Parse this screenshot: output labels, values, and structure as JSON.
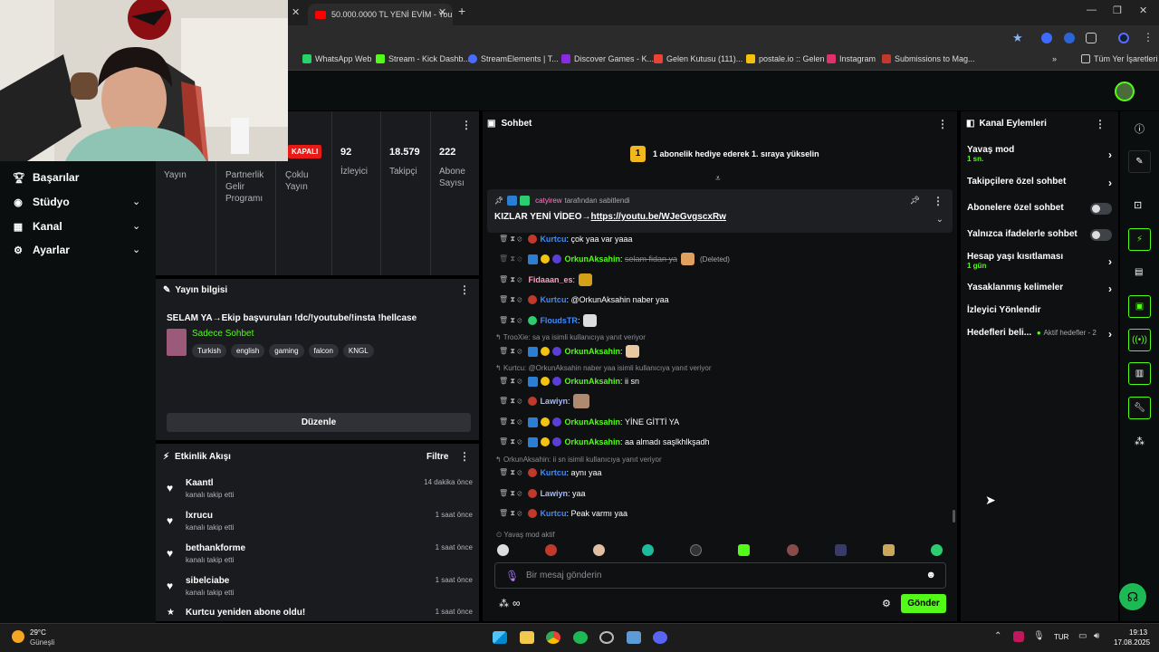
{
  "browser": {
    "tab_title": "50.000.0000 TL YENİ EVİM - You",
    "bookmarks": [
      {
        "label": "WhatsApp Web",
        "color": "#25d366"
      },
      {
        "label": "Stream - Kick Dashb...",
        "color": "#53fc18"
      },
      {
        "label": "StreamElements | T...",
        "color": "#4b6bff"
      },
      {
        "label": "Discover Games - K...",
        "color": "#8a2be2"
      },
      {
        "label": "Gelen Kutusu (111)...",
        "color": "#ea4335"
      },
      {
        "label": "postale.io :: Gelen",
        "color": "#f4c20d"
      },
      {
        "label": "Instagram",
        "color": "#e1306c"
      },
      {
        "label": "Submissions to Mag...",
        "color": "#c0392b"
      }
    ],
    "all_bookmarks": "Tüm Yer İşaretleri"
  },
  "nav": {
    "items": [
      {
        "label": "Başarılar",
        "icon": "trophy-icon"
      },
      {
        "label": "Stüdyo",
        "icon": "camera-icon"
      },
      {
        "label": "Kanal",
        "icon": "channel-icon"
      },
      {
        "label": "Ayarlar",
        "icon": "gear-icon"
      }
    ]
  },
  "stats": {
    "status": "KAPALI",
    "columns": [
      {
        "value": "",
        "label": "Yayın"
      },
      {
        "value": "",
        "label": "Partnerlik Gelir Programı"
      },
      {
        "value": "",
        "label": "Çoklu Yayın"
      },
      {
        "value": "92",
        "label": "İzleyici"
      },
      {
        "value": "18.579",
        "label": "Takipçi"
      },
      {
        "value": "222",
        "label": "Abone Sayısı"
      }
    ]
  },
  "stream_info": {
    "header": "Yayın bilgisi",
    "title": "SELAM YA→Ekip başvuruları !dc/!youtube/!insta !hellcase",
    "category": "Sadece Sohbet",
    "tags": [
      "Turkish",
      "english",
      "gaming",
      "falcon",
      "KNGL"
    ],
    "edit_label": "Düzenle"
  },
  "activity": {
    "header": "Etkinlik Akışı",
    "filter_label": "Filtre",
    "items": [
      {
        "name": "Kaantl",
        "action": "kanalı takip etti",
        "time": "14 dakika önce"
      },
      {
        "name": "lxrucu",
        "action": "kanalı takip etti",
        "time": "1 saat önce"
      },
      {
        "name": "bethankforme",
        "action": "kanalı takip etti",
        "time": "1 saat önce"
      },
      {
        "name": "sibelciabe",
        "action": "kanalı takip etti",
        "time": "1 saat önce"
      },
      {
        "name": "Kurtcu yeniden abone oldu!",
        "action": "",
        "time": "1 saat önce"
      }
    ]
  },
  "chat": {
    "header": "Sohbet",
    "gift_banner": "1 abonelik hediye ederek 1. sıraya yükselin",
    "gift_rank": "1",
    "pinned": {
      "by_user": "catyirew",
      "by_suffix": "tarafından sabitlendi",
      "text": "KIZLAR YENİ VİDEO→",
      "link": "https://youtu.be/WJeGvgscxRw"
    },
    "messages": [
      {
        "user": "Kurtcu",
        "color": "#3d8bff",
        "text": "çok yaa var yaaa",
        "badge": "#c0392b"
      },
      {
        "user": "OrkunAksahin",
        "color": "#53fc18",
        "text": "selam fidan ya",
        "deleted": "(Deleted)",
        "badge": "#f1c40f"
      },
      {
        "user": "Fidaaan_es",
        "color": "#ff9ec4",
        "text": "",
        "badge": "none"
      },
      {
        "user": "Kurtcu",
        "color": "#3d8bff",
        "text": "@OrkunAksahin naber yaa",
        "badge": "#c0392b"
      },
      {
        "user": "FloudsTR",
        "color": "#3d8bff",
        "text": "",
        "badge": "#2ecc71"
      },
      {
        "reply": "TrooXie: sa ya isimli kullanıcıya yanıt veriyor"
      },
      {
        "user": "OrkunAksahin",
        "color": "#53fc18",
        "text": "",
        "badge": "#f1c40f"
      },
      {
        "reply": "Kurtcu: @OrkunAksahin naber yaa isimli kullanıcıya yanıt veriyor"
      },
      {
        "user": "OrkunAksahin",
        "color": "#53fc18",
        "text": "ii sn",
        "badge": "#f1c40f"
      },
      {
        "user": "Lawiyn",
        "color": "#a4b8ff",
        "text": "",
        "badge": "#c0392b"
      },
      {
        "user": "OrkunAksahin",
        "color": "#53fc18",
        "text": "YİNE GİTTİ YA",
        "badge": "#f1c40f"
      },
      {
        "user": "OrkunAksahin",
        "color": "#53fc18",
        "text": "aa almadı saşlkhlkşadh",
        "badge": "#f1c40f"
      },
      {
        "reply": "OrkunAksahin: ii sn isimli kullanıcıya yanıt veriyor"
      },
      {
        "user": "Kurtcu",
        "color": "#3d8bff",
        "text": "aynı yaa",
        "badge": "#c0392b"
      },
      {
        "user": "Lawiyn",
        "color": "#a4b8ff",
        "text": "yaa",
        "badge": "#c0392b"
      },
      {
        "user": "Kurtcu",
        "color": "#3d8bff",
        "text": "Peak varmı yaa",
        "badge": "#c0392b"
      }
    ],
    "slow_mode_notice": "Yavaş mod aktif",
    "input_placeholder": "Bir mesaj gönderin",
    "send_label": "Gönder"
  },
  "actions": {
    "header": "Kanal Eylemleri",
    "slow_mode": {
      "label": "Yavaş mod",
      "value": "1 sn."
    },
    "followers_chat": "Takipçilere özel sohbet",
    "subscribers_chat": "Abonelere özel sohbet",
    "emote_only": "Yalnızca ifadelerle sohbet",
    "account_age": {
      "label": "Hesap yaşı kısıtlaması",
      "value": "1 gün"
    },
    "banned_words": "Yasaklanmış kelimeler",
    "redirect_viewers": "İzleyici Yönlendir",
    "goals": {
      "label": "Hedefleri beli...",
      "status": "Aktif hedefler - 2"
    }
  },
  "taskbar": {
    "weather_temp": "29°C",
    "weather_desc": "Güneşli",
    "lang": "TUR",
    "time": "19:13",
    "date": "17.08.2025"
  },
  "colors": {
    "kick_green": "#53fc18",
    "panel": "#191b1f",
    "chat_bg": "#0f1012"
  }
}
